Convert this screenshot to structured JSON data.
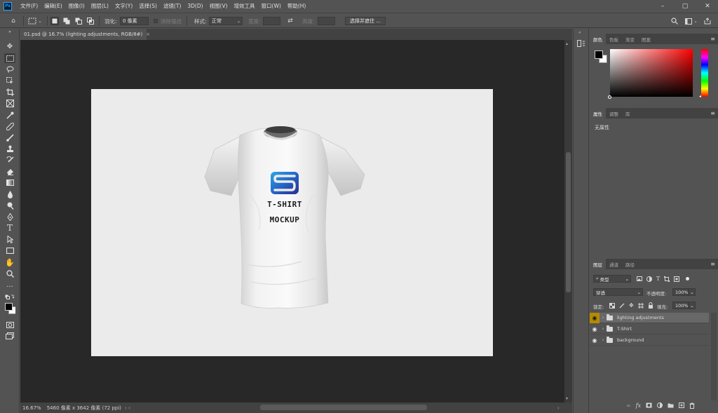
{
  "menu": {
    "logo": "Ps",
    "items": [
      "文件(F)",
      "编辑(E)",
      "图像(I)",
      "图层(L)",
      "文字(Y)",
      "选择(S)",
      "滤镜(T)",
      "3D(D)",
      "视图(V)",
      "增效工具",
      "窗口(W)",
      "帮助(H)"
    ]
  },
  "options": {
    "feather_label": "羽化:",
    "feather_value": "0 像素",
    "antialias_label": "消除锯齿",
    "style_label": "样式:",
    "style_value": "正常",
    "width_label": "宽度:",
    "height_label": "高度:",
    "select_mask_button": "选择并遮住 ..."
  },
  "document": {
    "tab_title": "01.psd @ 16.7% (lighting adjustments, RGB/8#)",
    "zoom": "16.67%",
    "doc_info": "5460 像素 x 3642 像素 (72 ppi)",
    "mockup_line1": "T-SHIRT",
    "mockup_line2": "MOCKUP"
  },
  "color_panel": {
    "tabs": [
      "颜色",
      "色板",
      "渐变",
      "图案"
    ],
    "accent": "#ff0000"
  },
  "properties_panel": {
    "tabs": [
      "属性",
      "调整",
      "库"
    ],
    "empty_text": "无属性"
  },
  "layers_panel": {
    "tabs": [
      "图层",
      "通道",
      "路径"
    ],
    "filter_kind": "类型",
    "blend_mode": "穿透",
    "opacity_label": "不透明度:",
    "opacity_value": "100%",
    "lock_label": "锁定:",
    "fill_label": "填充:",
    "fill_value": "100%",
    "layers": [
      {
        "name": "lighting adjustments",
        "selected": true
      },
      {
        "name": "T-Shirt",
        "selected": false
      },
      {
        "name": "background",
        "selected": false
      }
    ],
    "bottom_fx": "fx"
  }
}
